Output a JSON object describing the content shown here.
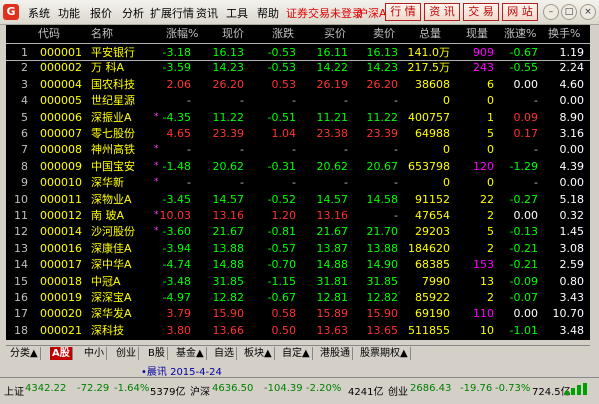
{
  "menubar": {
    "logo": "G",
    "items": [
      "系统",
      "功能",
      "报价",
      "分析",
      "扩展行情",
      "资讯",
      "工具",
      "帮助"
    ],
    "notice": "证券交易未登录",
    "market": "沪深A",
    "buttons": [
      "行 情",
      "资 讯",
      "交 易",
      "网 站"
    ]
  },
  "table": {
    "headers": [
      "代码",
      "名称",
      "涨幅%",
      "现价",
      "涨跌",
      "买价",
      "卖价",
      "总量",
      "现量",
      "涨速%",
      "换手%"
    ],
    "rows": [
      {
        "n": "1",
        "code": "000001",
        "name": "平安银行",
        "mark": "",
        "chg": "-3.18",
        "price": "16.13",
        "diff": "-0.53",
        "bid": "16.11",
        "ask": "16.13",
        "vol": "141.0万",
        "cur": "909",
        "spd": "-0.67",
        "turn": "1.19",
        "dir": "down"
      },
      {
        "n": "2",
        "code": "000002",
        "name": "万 科A",
        "mark": "",
        "chg": "-3.59",
        "price": "14.23",
        "diff": "-0.53",
        "bid": "14.22",
        "ask": "14.23",
        "vol": "217.5万",
        "cur": "243",
        "spd": "-0.55",
        "turn": "2.24",
        "dir": "down"
      },
      {
        "n": "3",
        "code": "000004",
        "name": "国农科技",
        "mark": "",
        "chg": "2.06",
        "price": "26.20",
        "diff": "0.53",
        "bid": "26.19",
        "ask": "26.20",
        "vol": "38608",
        "cur": "6",
        "spd": "0.00",
        "turn": "4.60",
        "dir": "up"
      },
      {
        "n": "4",
        "code": "000005",
        "name": "世纪星源",
        "mark": "",
        "chg": "-",
        "price": "-",
        "diff": "-",
        "bid": "-",
        "ask": "-",
        "vol": "0",
        "cur": "0",
        "spd": "-",
        "turn": "0.00",
        "dir": "none"
      },
      {
        "n": "5",
        "code": "000006",
        "name": "深振业A",
        "mark": "*",
        "chg": "-4.35",
        "price": "11.22",
        "diff": "-0.51",
        "bid": "11.21",
        "ask": "11.22",
        "vol": "400757",
        "cur": "1",
        "spd": "0.09",
        "turn": "8.90",
        "dir": "down"
      },
      {
        "n": "6",
        "code": "000007",
        "name": "零七股份",
        "mark": "",
        "chg": "4.65",
        "price": "23.39",
        "diff": "1.04",
        "bid": "23.38",
        "ask": "23.39",
        "vol": "64988",
        "cur": "5",
        "spd": "0.17",
        "turn": "3.16",
        "dir": "up"
      },
      {
        "n": "7",
        "code": "000008",
        "name": "神州高铁",
        "mark": "*",
        "chg": "-",
        "price": "-",
        "diff": "-",
        "bid": "-",
        "ask": "-",
        "vol": "0",
        "cur": "0",
        "spd": "-",
        "turn": "0.00",
        "dir": "none"
      },
      {
        "n": "8",
        "code": "000009",
        "name": "中国宝安",
        "mark": "*",
        "chg": "-1.48",
        "price": "20.62",
        "diff": "-0.31",
        "bid": "20.62",
        "ask": "20.67",
        "vol": "653798",
        "cur": "120",
        "spd": "-1.29",
        "turn": "4.39",
        "dir": "down"
      },
      {
        "n": "9",
        "code": "000010",
        "name": "深华新",
        "mark": "*",
        "chg": "-",
        "price": "-",
        "diff": "-",
        "bid": "-",
        "ask": "-",
        "vol": "0",
        "cur": "0",
        "spd": "-",
        "turn": "0.00",
        "dir": "none"
      },
      {
        "n": "10",
        "code": "000011",
        "name": "深物业A",
        "mark": "",
        "chg": "-3.45",
        "price": "14.57",
        "diff": "-0.52",
        "bid": "14.57",
        "ask": "14.58",
        "vol": "91152",
        "cur": "22",
        "spd": "-0.27",
        "turn": "5.18",
        "dir": "down"
      },
      {
        "n": "11",
        "code": "000012",
        "name": "南 玻A",
        "mark": "*",
        "chg": "10.03",
        "price": "13.16",
        "diff": "1.20",
        "bid": "13.16",
        "ask": "-",
        "vol": "47654",
        "cur": "2",
        "spd": "0.00",
        "turn": "0.32",
        "dir": "up"
      },
      {
        "n": "12",
        "code": "000014",
        "name": "沙河股份",
        "mark": "*",
        "chg": "-3.60",
        "price": "21.67",
        "diff": "-0.81",
        "bid": "21.67",
        "ask": "21.70",
        "vol": "29203",
        "cur": "5",
        "spd": "-0.13",
        "turn": "1.45",
        "dir": "down"
      },
      {
        "n": "13",
        "code": "000016",
        "name": "深康佳A",
        "mark": "",
        "chg": "-3.94",
        "price": "13.88",
        "diff": "-0.57",
        "bid": "13.87",
        "ask": "13.88",
        "vol": "184620",
        "cur": "2",
        "spd": "-0.21",
        "turn": "3.08",
        "dir": "down"
      },
      {
        "n": "14",
        "code": "000017",
        "name": "深中华A",
        "mark": "",
        "chg": "-4.74",
        "price": "14.88",
        "diff": "-0.70",
        "bid": "14.88",
        "ask": "14.90",
        "vol": "68385",
        "cur": "153",
        "spd": "-0.21",
        "turn": "2.59",
        "dir": "down"
      },
      {
        "n": "15",
        "code": "000018",
        "name": "中冠A",
        "mark": "",
        "chg": "-3.48",
        "price": "31.85",
        "diff": "-1.15",
        "bid": "31.81",
        "ask": "31.85",
        "vol": "7990",
        "cur": "13",
        "spd": "-0.09",
        "turn": "0.80",
        "dir": "down"
      },
      {
        "n": "16",
        "code": "000019",
        "name": "深深宝A",
        "mark": "",
        "chg": "-4.97",
        "price": "12.82",
        "diff": "-0.67",
        "bid": "12.81",
        "ask": "12.82",
        "vol": "85922",
        "cur": "2",
        "spd": "-0.07",
        "turn": "3.43",
        "dir": "down"
      },
      {
        "n": "17",
        "code": "000020",
        "name": "深华发A",
        "mark": "",
        "chg": "3.79",
        "price": "15.90",
        "diff": "0.58",
        "bid": "15.89",
        "ask": "15.90",
        "vol": "69190",
        "cur": "110",
        "spd": "0.00",
        "turn": "10.70",
        "dir": "up"
      },
      {
        "n": "18",
        "code": "000021",
        "name": "深科技",
        "mark": "",
        "chg": "3.80",
        "price": "13.66",
        "diff": "0.50",
        "bid": "13.63",
        "ask": "13.65",
        "vol": "511855",
        "cur": "10",
        "spd": "-1.01",
        "turn": "3.48",
        "dir": "up"
      }
    ]
  },
  "tabs": [
    "分类▲",
    "A股",
    "中小",
    "创业",
    "B股",
    "基金▲",
    "自选",
    "板块▲",
    "自定▲",
    "港股通",
    "股票期权▲"
  ],
  "active_tab": 1,
  "info": {
    "date": "•晨讯 2015-4-24"
  },
  "status": {
    "sh_label": "上证",
    "sh_val": "4342.22",
    "sh_diff": "-72.29",
    "sh_pct": "-1.64%",
    "sh_amt": "5379亿",
    "sz_label": "沪深",
    "sz_val": "4636.50",
    "sz_diff": "-104.39",
    "sz_pct": "-2.20%",
    "sz_amt": "4241亿",
    "cy_label": "创业",
    "cy_val": "2686.43",
    "cy_diff": "-19.76",
    "cy_pct": "-0.73%",
    "cy_amt": "724.5亿"
  },
  "colors": {
    "up": "#ff3232",
    "down": "#00ff00",
    "flat": "#ffffff"
  }
}
